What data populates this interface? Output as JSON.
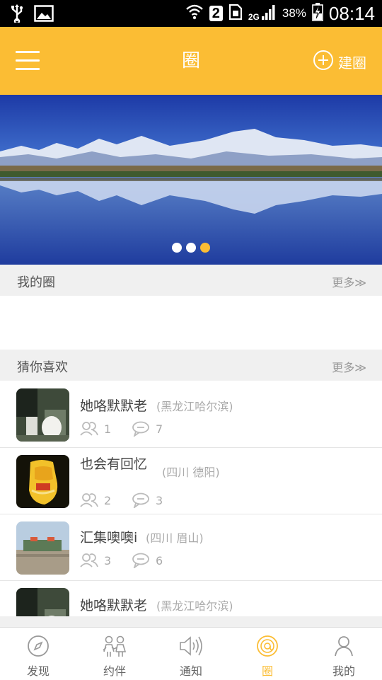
{
  "status_bar": {
    "sim_slot": "2",
    "network": "2G",
    "battery": "38%",
    "time": "08:14"
  },
  "header": {
    "title": "圈",
    "create_label": "建圈",
    "menu_icon": "menu-icon",
    "create_icon": "add-circle-icon"
  },
  "banner": {
    "page_count": 3,
    "active_index": 2
  },
  "my_circles": {
    "title": "我的圈",
    "more_label": "更多≫"
  },
  "recommended": {
    "title": "猜你喜欢",
    "more_label": "更多≫",
    "items": [
      {
        "name": "她咯默默老",
        "location": "(黑龙江哈尔滨)",
        "members": "1",
        "comments": "7"
      },
      {
        "name": "也会有回忆",
        "location": "(四川 德阳)",
        "members": "2",
        "comments": "3"
      },
      {
        "name": "汇集噢噢i",
        "location": "(四川 眉山)",
        "members": "3",
        "comments": "6"
      },
      {
        "name": "她咯默默老",
        "location": "(黑龙江哈尔滨)"
      }
    ]
  },
  "tabs": [
    {
      "label": "发现",
      "icon": "compass-icon"
    },
    {
      "label": "约伴",
      "icon": "companions-icon"
    },
    {
      "label": "通知",
      "icon": "speaker-icon"
    },
    {
      "label": "圈",
      "icon": "circle-at-icon",
      "active": true
    },
    {
      "label": "我的",
      "icon": "profile-icon"
    }
  ],
  "colors": {
    "accent": "#fbbd34",
    "status_bar": "#000000",
    "section_bg": "#f0f0f0"
  }
}
